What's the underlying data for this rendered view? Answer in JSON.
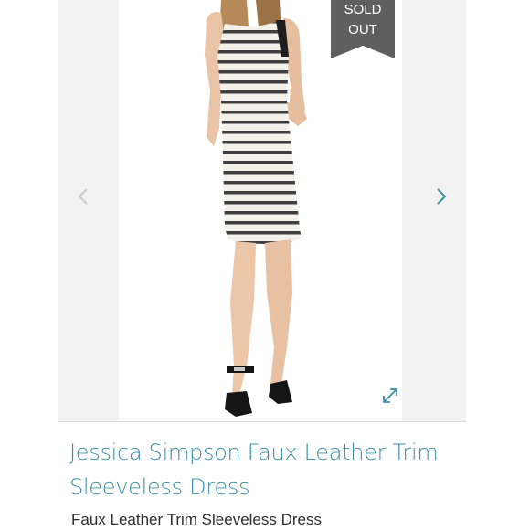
{
  "badge": {
    "line1": "SOLD",
    "line2": "OUT"
  },
  "product": {
    "title": "Jessica Simpson Faux Leather Trim Sleeveless Dress",
    "subtitle": "Faux Leather Trim Sleeveless Dress"
  },
  "icons": {
    "prev": "chevron-left-icon",
    "next": "chevron-right-icon",
    "expand": "expand-icon"
  },
  "colors": {
    "accent": "#3d8fa6",
    "badge": "#5f5f5f",
    "prev_arrow": "#c9c9c9"
  }
}
